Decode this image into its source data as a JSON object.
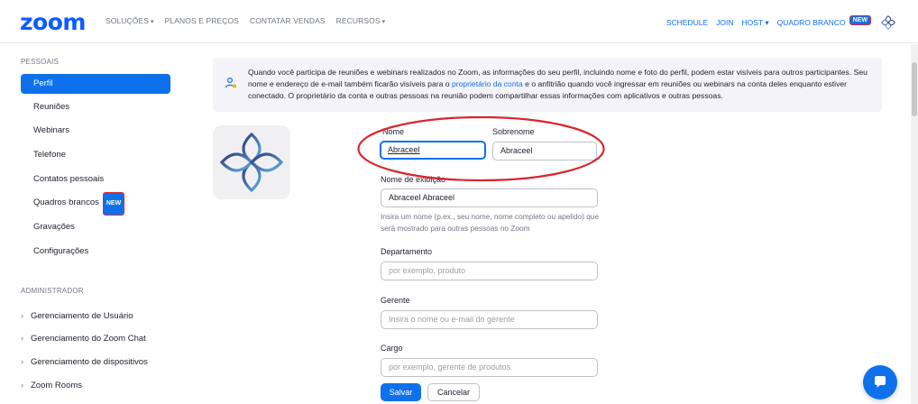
{
  "nav": {
    "logo": "zoom",
    "links": [
      {
        "label": "SOLUÇÕES",
        "caret": "▾"
      },
      {
        "label": "PLANOS E PREÇOS",
        "caret": ""
      },
      {
        "label": "CONTATAR VENDAS",
        "caret": ""
      },
      {
        "label": "RECURSOS",
        "caret": "▾"
      }
    ],
    "right": {
      "schedule": "SCHEDULE",
      "join": "JOIN",
      "host": "HOST ▾",
      "whiteboard": "QUADRO BRANCO",
      "new_badge": "NEW"
    }
  },
  "sidebar": {
    "personal_header": "PESSOAIS",
    "personal_items": [
      {
        "label": "Perfil",
        "active": true
      },
      {
        "label": "Reuniões"
      },
      {
        "label": "Webinars"
      },
      {
        "label": "Telefone"
      },
      {
        "label": "Contatos pessoais"
      },
      {
        "label": "Quadros brancos",
        "badge": "NEW"
      },
      {
        "label": "Gravações"
      },
      {
        "label": "Configurações"
      }
    ],
    "admin_header": "ADMINISTRADOR",
    "admin_items": [
      {
        "label": "Gerenciamento de Usuário"
      },
      {
        "label": "Gerenciamento do Zoom Chat"
      },
      {
        "label": "Gerenciamento de dispositivos"
      },
      {
        "label": "Zoom Rooms"
      }
    ]
  },
  "banner": {
    "text_before": "Quando você participa de reuniões e webinars realizados no Zoom, as informações do seu perfil, incluindo nome e foto do perfil, podem estar visíveis para outros participantes. Seu nome e endereço de e-mail também ficarão visíveis para o ",
    "link": "proprietário da conta",
    "text_after": " e o anfitrião quando você ingressar em reuniões ou webinars na conta deles enquanto estiver conectado. O proprietário da conta e outras pessoas na reunião podem compartilhar essas informações com aplicativos e outras pessoas."
  },
  "form": {
    "first_name_label": "Nome",
    "first_name_value": "Abraceel",
    "last_name_label": "Sobrenome",
    "last_name_value": "Abraceel",
    "display_name_label": "Nome de exibição",
    "display_name_value": "Abraceel Abraceel",
    "display_name_help": "Insira um nome (p.ex., seu nome, nome completo ou apelido) que será mostrado para outras pessoas no Zoom",
    "department_label": "Departamento",
    "department_placeholder": "por exemplo, produto",
    "manager_label": "Gerente",
    "manager_placeholder": "Insira o nome ou e-mail do gerente",
    "job_title_label": "Cargo",
    "job_title_placeholder": "por exemplo, gerente de produtos",
    "save_label": "Salvar",
    "cancel_label": "Cancelar"
  },
  "colors": {
    "brand": "#0b5cff",
    "accent": "#0e71eb",
    "highlight": "#d9262e"
  }
}
